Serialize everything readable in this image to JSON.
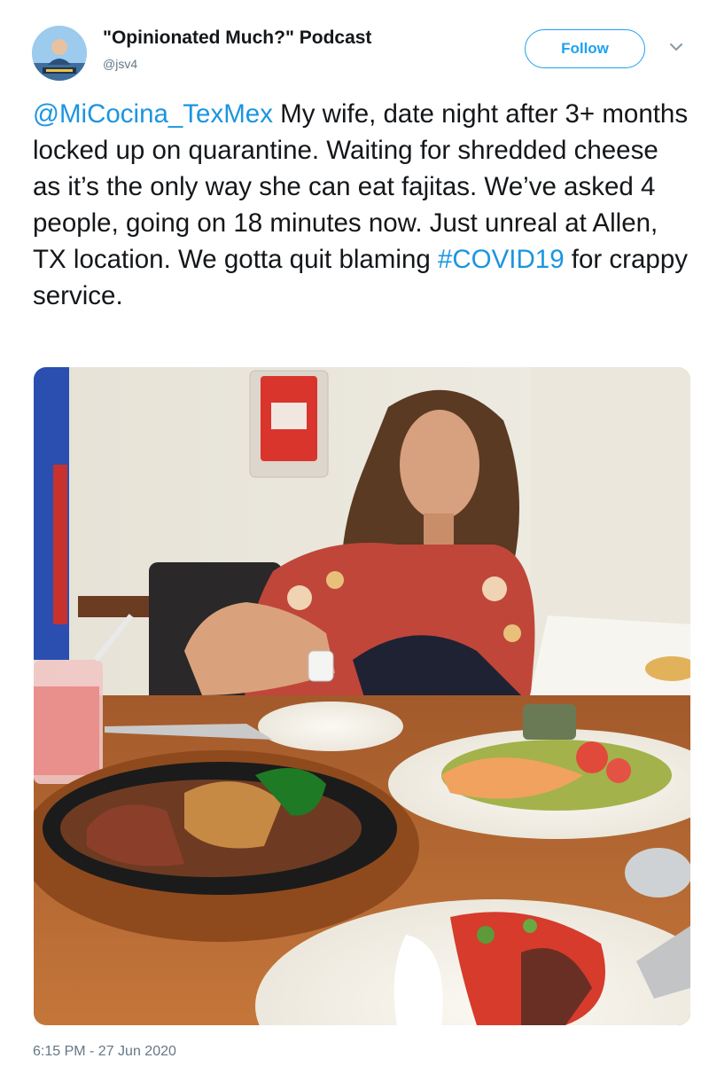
{
  "author": {
    "display_name": "\"Opinionated Much?\" Podcast",
    "handle": "@jsv4",
    "avatar_icon": "podcast-avatar-icon"
  },
  "actions": {
    "follow_label": "Follow",
    "more_icon": "chevron-down-icon"
  },
  "tweet": {
    "mention": "@MiCocina_TexMex",
    "text_before_hashtag": " My wife, date night after 3+ months locked up on quarantine. Waiting for shredded cheese as it’s the only way she can eat fajitas. We’ve asked 4 people, going on 18 minutes now. Just unreal at Allen, TX location. We gotta quit blaming ",
    "hashtag": "#COVID19",
    "text_after_hashtag": " for crappy service."
  },
  "media": {
    "kind": "photo",
    "icon": "photo-restaurant-table"
  },
  "timestamp": "6:15 PM - 27 Jun 2020",
  "colors": {
    "link": "#1b95e0",
    "follow": "#1da1f2",
    "secondary_text": "#657786",
    "primary_text": "#14171a"
  }
}
